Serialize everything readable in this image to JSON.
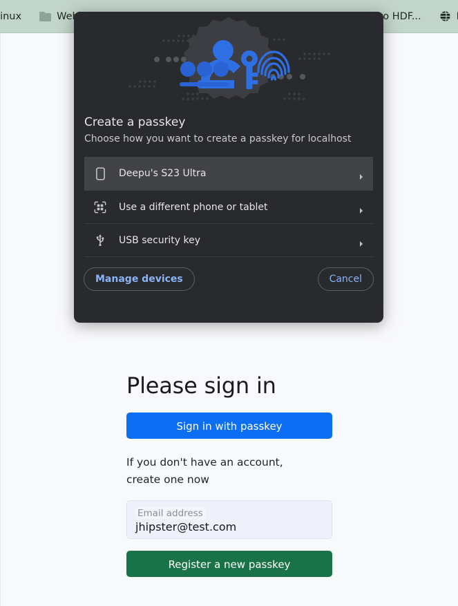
{
  "browser": {
    "bookmarks_left": [
      {
        "icon": "",
        "label": "Linux"
      },
      {
        "icon": "folder-icon",
        "label": "Web te"
      }
    ],
    "bookmarks_right": [
      {
        "icon": "",
        "label": "e to HDF..."
      },
      {
        "icon": "globe-icon",
        "label": "F"
      }
    ]
  },
  "dialog": {
    "title": "Create a passkey",
    "subtitle": "Choose how you want to create a passkey for localhost",
    "options": [
      {
        "icon": "phone-icon",
        "label": "Deepu's S23 Ultra",
        "selected": true
      },
      {
        "icon": "qr-code-icon",
        "label": "Use a different phone or tablet",
        "selected": false
      },
      {
        "icon": "usb-icon",
        "label": "USB security key",
        "selected": false
      }
    ],
    "manage_devices_label": "Manage devices",
    "cancel_label": "Cancel",
    "colors": {
      "background": "#292a2d",
      "selected_row": "#414347",
      "accent_link": "#8ab4f8",
      "illustration_blue": "#2f6fe4"
    }
  },
  "signin": {
    "title": "Please sign in",
    "signin_button_label": "Sign in with passkey",
    "helper_text": "If you don't have an account, create one now",
    "email": {
      "label": "Email address",
      "value": "jhipster@test.com"
    },
    "register_button_label": "Register a new passkey",
    "colors": {
      "primary": "#0c6ef2",
      "success": "#1a7348",
      "page_background": "#f8f9fb",
      "bookmarks_bar": "#c2d5ca"
    }
  }
}
